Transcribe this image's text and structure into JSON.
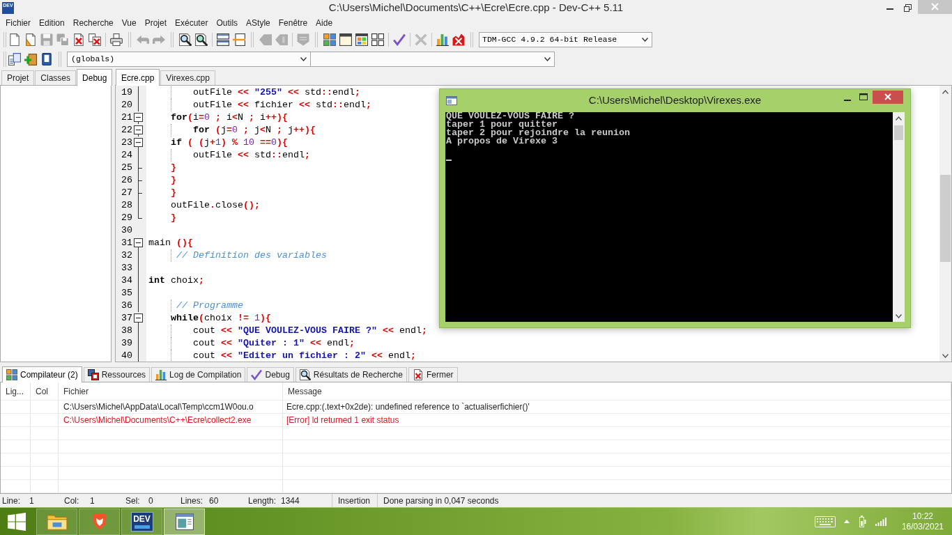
{
  "window": {
    "icon_text": "DEV",
    "title": "C:\\Users\\Michel\\Documents\\C++\\Ecre\\Ecre.cpp - Dev-C++ 5.11"
  },
  "menu": [
    "Fichier",
    "Edition",
    "Recherche",
    "Vue",
    "Projet",
    "Exécuter",
    "Outils",
    "AStyle",
    "Fenêtre",
    "Aide"
  ],
  "main_toolbar": {
    "toolbars": [
      {
        "groups": [
          {
            "buttons": [
              {
                "kind": "page",
                "disabled": false
              },
              {
                "kind": "page_wedge",
                "disabled": false
              },
              {
                "kind": "floppy",
                "disabled": true
              },
              {
                "kind": "floppies",
                "disabled": true
              },
              {
                "kind": "page_cross",
                "disabled": false
              },
              {
                "kind": "pages_cross",
                "disabled": false
              }
            ]
          },
          {
            "buttons": [
              {
                "kind": "printer",
                "disabled": false
              }
            ]
          }
        ]
      },
      {
        "groups": [
          {
            "buttons": [
              {
                "kind": "undo",
                "disabled": true
              },
              {
                "kind": "redo",
                "disabled": true
              }
            ]
          }
        ]
      },
      {
        "groups": [
          {
            "buttons": [
              {
                "kind": "find",
                "disabled": false
              },
              {
                "kind": "find_page",
                "disabled": false
              }
            ]
          },
          {
            "buttons": [
              {
                "kind": "panes",
                "disabled": false
              },
              {
                "kind": "split",
                "disabled": false
              }
            ]
          }
        ]
      },
      {
        "groups": [
          {
            "buttons": [
              {
                "kind": "tag_left",
                "disabled": true
              },
              {
                "kind": "tag_right",
                "disabled": true
              }
            ]
          },
          {
            "buttons": [
              {
                "kind": "badge",
                "disabled": true
              }
            ]
          }
        ]
      },
      {
        "groups": [
          {
            "buttons": [
              {
                "kind": "tiles",
                "disabled": false
              },
              {
                "kind": "window",
                "disabled": false
              },
              {
                "kind": "tiled_window",
                "disabled": false
              },
              {
                "kind": "grid",
                "disabled": false
              }
            ]
          },
          {
            "buttons": [
              {
                "kind": "check",
                "disabled": false
              }
            ]
          },
          {
            "buttons": [
              {
                "kind": "cross",
                "disabled": true
              }
            ]
          },
          {
            "buttons": [
              {
                "kind": "chart",
                "disabled": false
              },
              {
                "kind": "chart_cross",
                "disabled": false
              }
            ]
          }
        ]
      }
    ],
    "compiler_select": "TDM-GCC 4.9.2 64-bit Release"
  },
  "class_toolbar": {
    "buttons": [
      {
        "kind": "pages",
        "disabled": false
      },
      {
        "kind": "plus_box",
        "disabled": false
      },
      {
        "kind": "book",
        "disabled": false
      }
    ],
    "scope_select": "(globals)"
  },
  "side_panel": {
    "tabs": [
      {
        "label": "Projet",
        "selected": false
      },
      {
        "label": "Classes",
        "selected": false
      },
      {
        "label": "Debug",
        "selected": true
      }
    ]
  },
  "editor": {
    "tabs": [
      {
        "label": "Ecre.cpp",
        "selected": true
      },
      {
        "label": "Virexes.cpp",
        "selected": false
      }
    ],
    "lines": [
      {
        "number": "19",
        "kind": "fold_line",
        "tokens": [
          {
            "kind": "plain",
            "text": "        outFile "
          },
          {
            "kind": "symbol",
            "text": "<< "
          },
          {
            "kind": "string",
            "text": "\"255\" "
          },
          {
            "kind": "symbol",
            "text": "<<"
          },
          {
            "kind": "plain",
            "text": " std"
          },
          {
            "kind": "symbol",
            "text": "::"
          },
          {
            "kind": "plain",
            "text": "endl"
          },
          {
            "kind": "symbol",
            "text": ";"
          }
        ]
      },
      {
        "number": "20",
        "kind": "fold_line",
        "tokens": [
          {
            "kind": "plain",
            "text": "        outFile "
          },
          {
            "kind": "symbol",
            "text": "<<"
          },
          {
            "kind": "plain",
            "text": " fichier "
          },
          {
            "kind": "symbol",
            "text": "<<"
          },
          {
            "kind": "plain",
            "text": " std"
          },
          {
            "kind": "symbol",
            "text": "::"
          },
          {
            "kind": "plain",
            "text": "endl"
          },
          {
            "kind": "symbol",
            "text": ";"
          }
        ]
      },
      {
        "number": "21",
        "kind": "fold_open",
        "tokens": [
          {
            "kind": "keyword",
            "text": "    for"
          },
          {
            "kind": "symbol",
            "text": "("
          },
          {
            "kind": "plain",
            "text": "i"
          },
          {
            "kind": "symbol",
            "text": "="
          },
          {
            "kind": "number",
            "text": "0 "
          },
          {
            "kind": "symbol",
            "text": ";"
          },
          {
            "kind": "plain",
            "text": " i"
          },
          {
            "kind": "symbol",
            "text": "<"
          },
          {
            "kind": "plain",
            "text": "N "
          },
          {
            "kind": "symbol",
            "text": ";"
          },
          {
            "kind": "plain",
            "text": " i"
          },
          {
            "kind": "symbol",
            "text": "++){"
          }
        ]
      },
      {
        "number": "22",
        "kind": "fold_open",
        "tokens": [
          {
            "kind": "keyword",
            "text": "        for "
          },
          {
            "kind": "symbol",
            "text": "("
          },
          {
            "kind": "plain",
            "text": "j"
          },
          {
            "kind": "symbol",
            "text": "="
          },
          {
            "kind": "number",
            "text": "0 "
          },
          {
            "kind": "symbol",
            "text": ";"
          },
          {
            "kind": "plain",
            "text": " j"
          },
          {
            "kind": "symbol",
            "text": "<"
          },
          {
            "kind": "plain",
            "text": "N "
          },
          {
            "kind": "symbol",
            "text": ";"
          },
          {
            "kind": "plain",
            "text": " j"
          },
          {
            "kind": "symbol",
            "text": "++){"
          }
        ]
      },
      {
        "number": "23",
        "kind": "fold_open",
        "tokens": [
          {
            "kind": "keyword",
            "text": "    if "
          },
          {
            "kind": "symbol",
            "text": "( ("
          },
          {
            "kind": "plain",
            "text": "j"
          },
          {
            "kind": "symbol",
            "text": "+"
          },
          {
            "kind": "number",
            "text": "1"
          },
          {
            "kind": "symbol",
            "text": ") % "
          },
          {
            "kind": "number",
            "text": "10 "
          },
          {
            "kind": "symbol",
            "text": "=="
          },
          {
            "kind": "number",
            "text": "0"
          },
          {
            "kind": "symbol",
            "text": "){"
          }
        ]
      },
      {
        "number": "24",
        "kind": "fold_line",
        "tokens": [
          {
            "kind": "plain",
            "text": "        outFile "
          },
          {
            "kind": "symbol",
            "text": "<<"
          },
          {
            "kind": "plain",
            "text": " std"
          },
          {
            "kind": "symbol",
            "text": "::"
          },
          {
            "kind": "plain",
            "text": "endl"
          },
          {
            "kind": "symbol",
            "text": ";"
          }
        ]
      },
      {
        "number": "25",
        "kind": "fold_branch",
        "tokens": [
          {
            "kind": "symbol",
            "text": "    }"
          }
        ]
      },
      {
        "number": "26",
        "kind": "fold_branch",
        "tokens": [
          {
            "kind": "symbol",
            "text": "    }"
          }
        ]
      },
      {
        "number": "27",
        "kind": "fold_branch",
        "tokens": [
          {
            "kind": "symbol",
            "text": "    }"
          }
        ]
      },
      {
        "number": "28",
        "kind": "fold_line",
        "tokens": [
          {
            "kind": "plain",
            "text": "    outFile"
          },
          {
            "kind": "symbol",
            "text": "."
          },
          {
            "kind": "plain",
            "text": "close"
          },
          {
            "kind": "symbol",
            "text": "();"
          }
        ]
      },
      {
        "number": "29",
        "kind": "fold_end",
        "tokens": [
          {
            "kind": "symbol",
            "text": "    }"
          }
        ]
      },
      {
        "number": "30",
        "kind": "blank"
      },
      {
        "number": "31",
        "kind": "fold_open",
        "tokens": [
          {
            "kind": "plain",
            "text": "main "
          },
          {
            "kind": "symbol",
            "text": "(){"
          }
        ]
      },
      {
        "number": "32",
        "kind": "fold_line",
        "tokens": [
          {
            "kind": "comment",
            "text": "     // Definition des variables"
          }
        ]
      },
      {
        "number": "33",
        "kind": "fold_line"
      },
      {
        "number": "34",
        "kind": "fold_line",
        "tokens": [
          {
            "kind": "keyword",
            "text": "int"
          },
          {
            "kind": "plain",
            "text": " choix"
          },
          {
            "kind": "symbol",
            "text": ";"
          }
        ]
      },
      {
        "number": "35",
        "kind": "fold_line"
      },
      {
        "number": "36",
        "kind": "fold_line",
        "tokens": [
          {
            "kind": "comment",
            "text": "     // Programme"
          }
        ]
      },
      {
        "number": "37",
        "kind": "fold_open",
        "tokens": [
          {
            "kind": "keyword",
            "text": "    while"
          },
          {
            "kind": "symbol",
            "text": "("
          },
          {
            "kind": "plain",
            "text": "choix "
          },
          {
            "kind": "symbol",
            "text": "!= "
          },
          {
            "kind": "number",
            "text": "1"
          },
          {
            "kind": "symbol",
            "text": "){"
          }
        ]
      },
      {
        "number": "38",
        "kind": "fold_line",
        "tokens": [
          {
            "kind": "plain",
            "text": "        cout "
          },
          {
            "kind": "symbol",
            "text": "<< "
          },
          {
            "kind": "string",
            "text": "\"QUE VOULEZ-VOUS FAIRE ?\" "
          },
          {
            "kind": "symbol",
            "text": "<<"
          },
          {
            "kind": "plain",
            "text": " endl"
          },
          {
            "kind": "symbol",
            "text": ";"
          }
        ]
      },
      {
        "number": "39",
        "kind": "fold_line",
        "tokens": [
          {
            "kind": "plain",
            "text": "        cout "
          },
          {
            "kind": "symbol",
            "text": "<< "
          },
          {
            "kind": "string",
            "text": "\"Quiter : 1\" "
          },
          {
            "kind": "symbol",
            "text": "<<"
          },
          {
            "kind": "plain",
            "text": " endl"
          },
          {
            "kind": "symbol",
            "text": ";"
          }
        ]
      },
      {
        "number": "40",
        "kind": "fold_line",
        "tokens": [
          {
            "kind": "plain",
            "text": "        cout "
          },
          {
            "kind": "symbol",
            "text": "<< "
          },
          {
            "kind": "string",
            "text": "\"Editer un fichier : 2\" "
          },
          {
            "kind": "symbol",
            "text": "<<"
          },
          {
            "kind": "plain",
            "text": " endl"
          },
          {
            "kind": "symbol",
            "text": ";"
          }
        ]
      }
    ]
  },
  "console": {
    "title": "C:\\Users\\Michel\\Desktop\\Virexes.exe",
    "lines": [
      "QUE VOULEZ-VOUS FAIRE ?",
      "taper 1 pour quitter",
      "taper 2 pour rejoindre la reunion",
      "A propos de Virexe 3"
    ]
  },
  "output_panel": {
    "tabs": [
      {
        "label": "Compilateur (2)",
        "kind": "tiles",
        "selected": true
      },
      {
        "label": "Ressources",
        "kind": "overlap",
        "selected": false
      },
      {
        "label": "Log de Compilation",
        "kind": "chart",
        "selected": false
      },
      {
        "label": "Debug",
        "kind": "check",
        "selected": false
      },
      {
        "label": "Résultats de Recherche",
        "kind": "find",
        "selected": false
      },
      {
        "label": "Fermer",
        "kind": "page_cross",
        "selected": false
      }
    ],
    "table": {
      "columns": [
        "Lig...",
        "Col",
        "Fichier",
        "Message"
      ],
      "rows": [
        {
          "file": "C:\\Users\\Michel\\AppData\\Local\\Temp\\ccm1W0ou.o",
          "message": "Ecre.cpp:(.text+0x2de): undefined reference to `actualiserfichier()'",
          "error": false
        },
        {
          "file": "C:\\Users\\Michel\\Documents\\C++\\Ecre\\collect2.exe",
          "message": "[Error] ld returned 1 exit status",
          "error": true
        }
      ]
    }
  },
  "status_bar": [
    {
      "label": "Line:",
      "value": "1"
    },
    {
      "label": "Col:",
      "value": "1"
    },
    {
      "label": "Sel:",
      "value": "0"
    },
    {
      "label": "Lines:",
      "value": "60"
    },
    {
      "label": "Length:",
      "value": "1344"
    },
    {
      "value": "Insertion"
    },
    {
      "value": "Done parsing in 0,047 seconds"
    }
  ],
  "taskbar": {
    "apps": [
      {
        "kind": "folder",
        "selected": false
      },
      {
        "kind": "shield",
        "selected": false
      },
      {
        "kind": "dev",
        "label": "DEV",
        "selected": false
      },
      {
        "kind": "window",
        "selected": true
      }
    ],
    "clock": {
      "time": "10:22",
      "date": "16/03/2021"
    }
  }
}
